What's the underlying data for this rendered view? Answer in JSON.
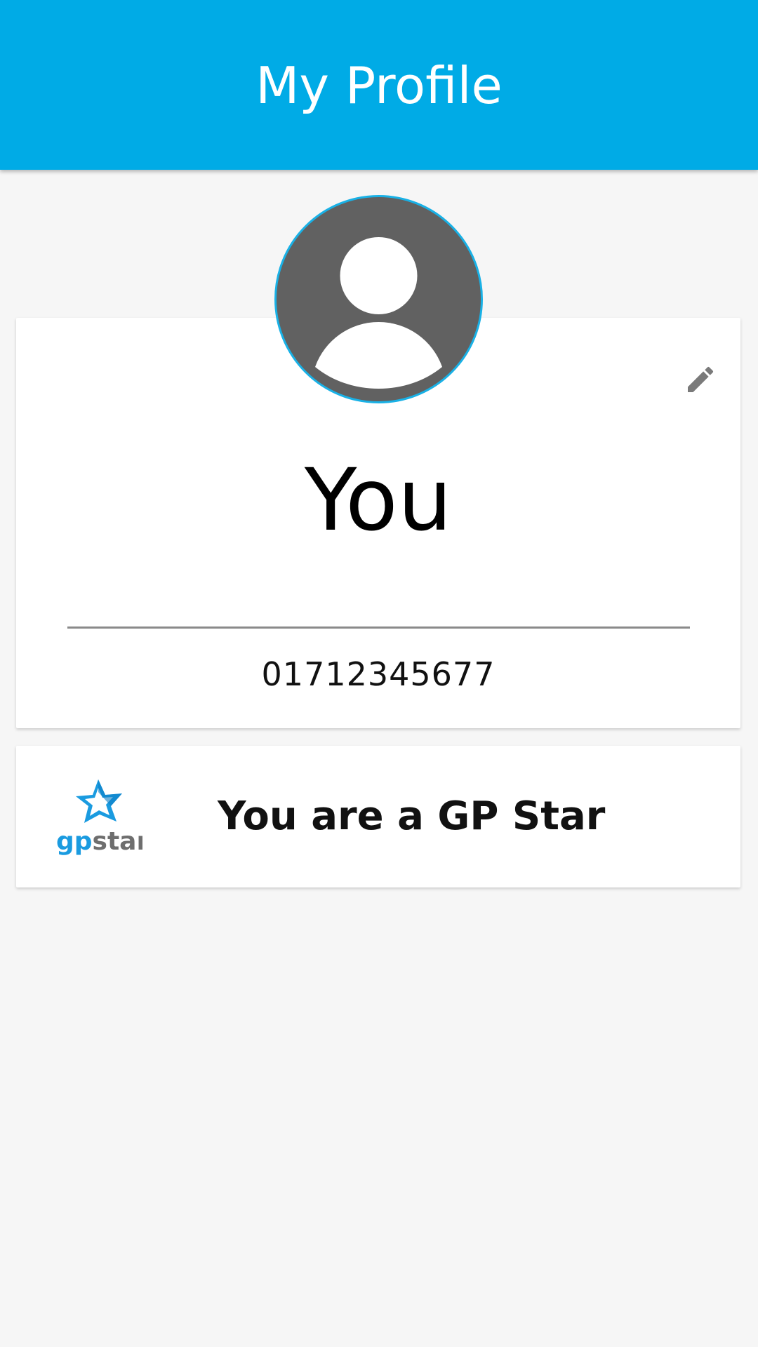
{
  "header": {
    "title": "My Profile",
    "background_color": "#00abe6"
  },
  "profile": {
    "avatar_icon": "default-user-avatar-icon",
    "edit_icon": "pencil-icon",
    "name": "You",
    "phone": "01712345677"
  },
  "status_card": {
    "logo_icon": "gpstar-logo",
    "logo_text": "gpstar",
    "message": "You are a GP Star"
  }
}
